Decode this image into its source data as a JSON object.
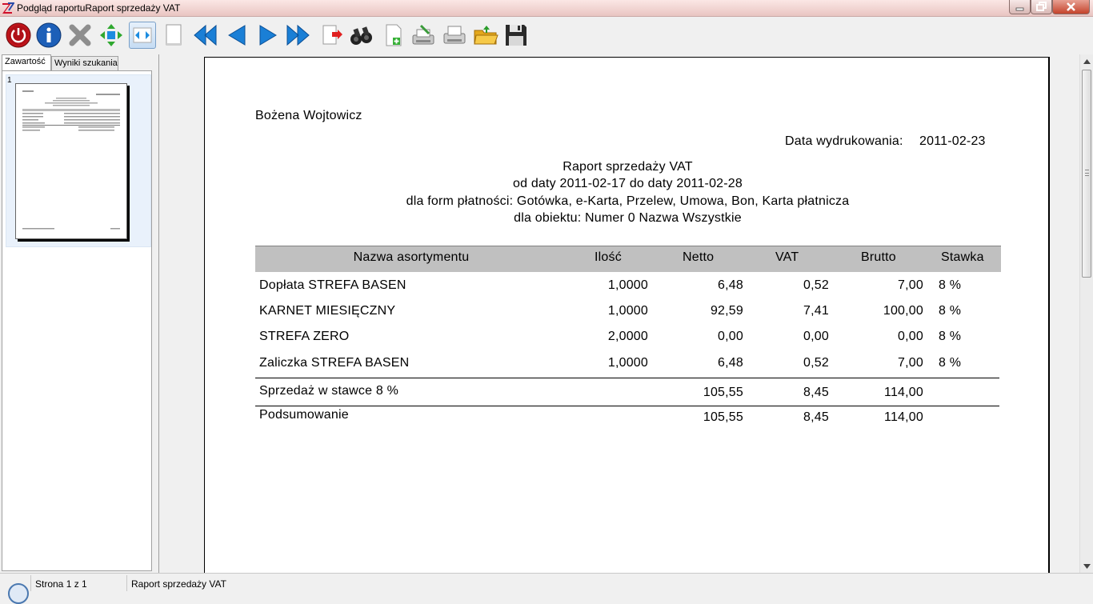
{
  "window": {
    "title": "Podgląd raportuRaport sprzedaży VAT"
  },
  "toolbar": {
    "buttons": [
      {
        "name": "power-icon",
        "label": "Zamknij"
      },
      {
        "name": "info-icon",
        "label": "Informacje"
      },
      {
        "name": "close-x-icon",
        "label": "Anuluj"
      },
      {
        "name": "fit-page-icon",
        "label": "Cała strona"
      },
      {
        "name": "fit-width-icon",
        "label": "Szerokość strony"
      },
      {
        "name": "page-icon",
        "label": "Strona"
      },
      {
        "name": "first-page-icon",
        "label": "Pierwsza strona"
      },
      {
        "name": "prev-page-icon",
        "label": "Poprzednia strona"
      },
      {
        "name": "next-page-icon",
        "label": "Następna strona"
      },
      {
        "name": "last-page-icon",
        "label": "Ostatnia strona"
      },
      {
        "name": "goto-page-icon",
        "label": "Idź do strony"
      },
      {
        "name": "binoculars-icon",
        "label": "Szukaj"
      },
      {
        "name": "new-page-icon",
        "label": "Nowa strona"
      },
      {
        "name": "print-setup-icon",
        "label": "Ustawienia wydruku"
      },
      {
        "name": "printer-icon",
        "label": "Drukuj"
      },
      {
        "name": "open-folder-icon",
        "label": "Otwórz"
      },
      {
        "name": "save-icon",
        "label": "Zapisz"
      }
    ]
  },
  "left_panel": {
    "tabs": [
      {
        "label": "Zawartość"
      },
      {
        "label": "Wyniki szukania"
      }
    ],
    "thumbnail_number": "1"
  },
  "report": {
    "user_name": "Bożena Wojtowicz",
    "print_date_label": "Data wydrukowania:",
    "print_date": "2011-02-23",
    "title": "Raport sprzedaży VAT",
    "date_range": "od daty 2011-02-17 do daty 2011-02-28",
    "payment_forms": "dla form płatności: Gotówka, e-Karta, Przelew, Umowa, Bon, Karta płatnicza",
    "object_line": "dla obiektu: Numer 0 Nazwa Wszystkie",
    "columns": [
      "Nazwa asortymentu",
      "Ilość",
      "Netto",
      "VAT",
      "Brutto",
      "Stawka"
    ],
    "rows": [
      {
        "name": "Dopłata STREFA BASEN",
        "qty": "1,0000",
        "net": "6,48",
        "vat": "0,52",
        "gross": "7,00",
        "rate": "8 %"
      },
      {
        "name": "KARNET MIESIĘCZNY",
        "qty": "1,0000",
        "net": "92,59",
        "vat": "7,41",
        "gross": "100,00",
        "rate": "8 %"
      },
      {
        "name": "STREFA ZERO",
        "qty": "2,0000",
        "net": "0,00",
        "vat": "0,00",
        "gross": "0,00",
        "rate": "8 %"
      },
      {
        "name": "Zaliczka STREFA BASEN",
        "qty": "1,0000",
        "net": "6,48",
        "vat": "0,52",
        "gross": "7,00",
        "rate": "8 %"
      }
    ],
    "subtotal": {
      "label": "Sprzedaż w stawce 8 %",
      "net": "105,55",
      "vat": "8,45",
      "gross": "114,00"
    },
    "total": {
      "label": "Podsumowanie",
      "net": "105,55",
      "vat": "8,45",
      "gross": "114,00"
    }
  },
  "status": {
    "page": "Strona 1 z 1",
    "report_name": "Raport sprzedaży VAT"
  }
}
